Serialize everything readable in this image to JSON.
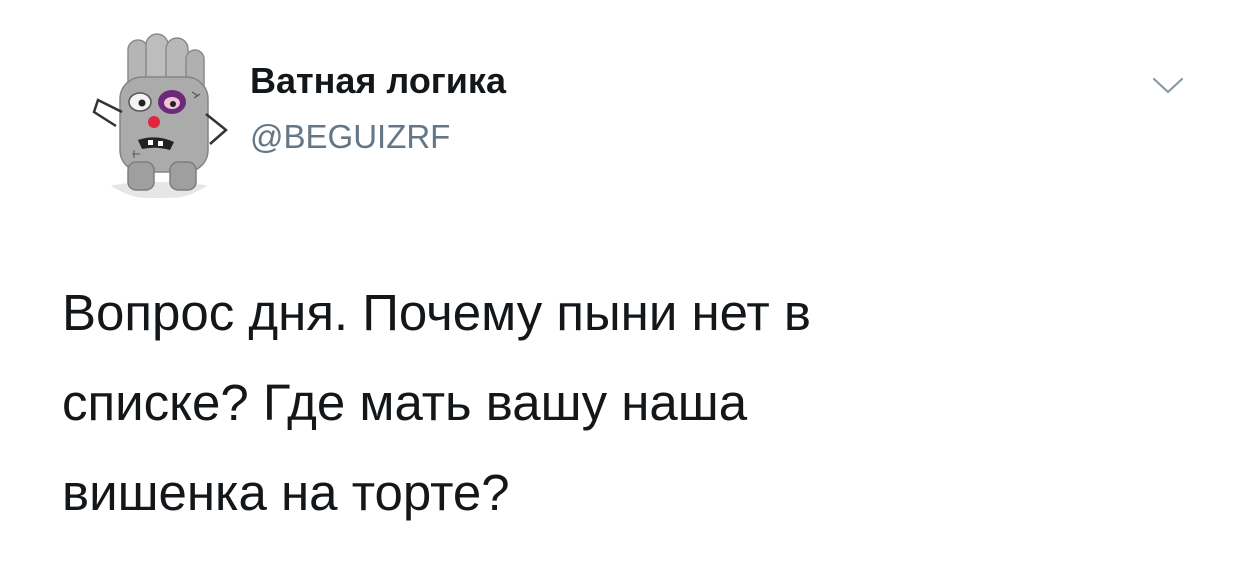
{
  "tweet": {
    "author": {
      "display_name": "Ватная логика",
      "handle": "@BEGUIZRF",
      "avatar_icon": "cotton-glove-character-avatar"
    },
    "menu_icon": "chevron-down-icon",
    "text": "Вопрос дня. Почему пыни  нет в\nсписке? Где мать вашу наша\nвишенка на торте?"
  },
  "colors": {
    "text": "#14171a",
    "secondary": "#657786",
    "caret": "#8899a6",
    "background": "#ffffff"
  }
}
